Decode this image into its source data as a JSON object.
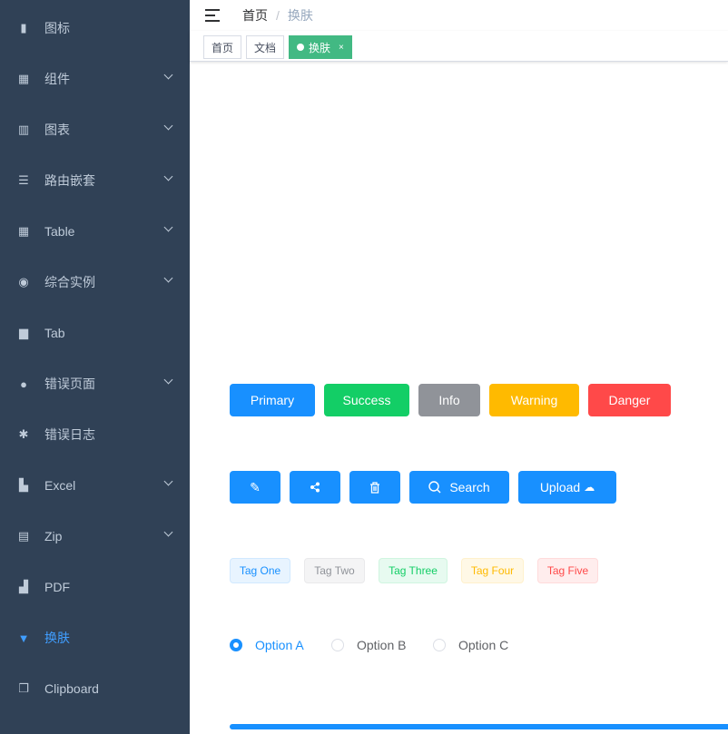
{
  "sidebar": {
    "items": [
      {
        "label": "图标",
        "icon": "icon-icon",
        "sub": false
      },
      {
        "label": "组件",
        "icon": "component-icon",
        "sub": true
      },
      {
        "label": "图表",
        "icon": "chart-icon",
        "sub": true
      },
      {
        "label": "路由嵌套",
        "icon": "nested-icon",
        "sub": true
      },
      {
        "label": "Table",
        "icon": "table-icon",
        "sub": true
      },
      {
        "label": "综合实例",
        "icon": "example-icon",
        "sub": true
      },
      {
        "label": "Tab",
        "icon": "tab-icon",
        "sub": false
      },
      {
        "label": "错误页面",
        "icon": "404-icon",
        "sub": true
      },
      {
        "label": "错误日志",
        "icon": "bug-icon",
        "sub": false
      },
      {
        "label": "Excel",
        "icon": "excel-icon",
        "sub": true
      },
      {
        "label": "Zip",
        "icon": "zip-icon",
        "sub": true
      },
      {
        "label": "PDF",
        "icon": "pdf-icon",
        "sub": false
      },
      {
        "label": "换肤",
        "icon": "theme-icon",
        "sub": false,
        "active": true
      },
      {
        "label": "Clipboard",
        "icon": "clipboard-icon",
        "sub": false
      }
    ]
  },
  "breadcrumb": {
    "home": "首页",
    "current": "换肤"
  },
  "tags": {
    "items": [
      "首页",
      "文档",
      "换肤"
    ],
    "close": "×"
  },
  "buttons": {
    "primary": "Primary",
    "success": "Success",
    "info": "Info",
    "warning": "Warning",
    "danger": "Danger",
    "search": "Search",
    "upload": "Upload"
  },
  "tag_list": [
    "Tag One",
    "Tag Two",
    "Tag Three",
    "Tag Four",
    "Tag Five"
  ],
  "radios": {
    "options": [
      "Option A",
      "Option B",
      "Option C"
    ],
    "selected": "Option A"
  },
  "colors": {
    "sidebar": "#304156",
    "primary": "#1890ff",
    "success": "#13ce66",
    "info": "#909399",
    "warning": "#ffba00",
    "danger": "#ff4949",
    "tag_active": "#42b983"
  },
  "progress": {
    "percent": 100
  }
}
